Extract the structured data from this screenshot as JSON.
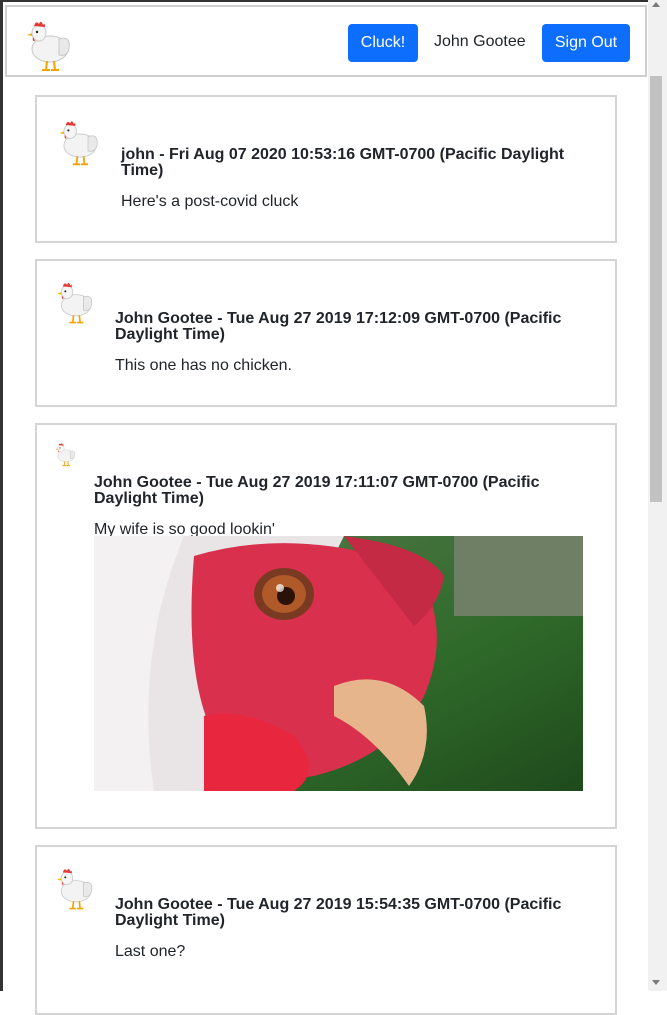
{
  "header": {
    "logo": "chicken-icon",
    "cluck_label": "Cluck!",
    "user_name": "John Gootee",
    "signout_label": "Sign Out"
  },
  "colors": {
    "primary": "#0d6efd",
    "border": "#d4d4d4"
  },
  "posts": [
    {
      "meta": "john - Fri Aug 07 2020 10:53:16 GMT-0700 (Pacific Daylight Time)",
      "text": "Here's a post-covid cluck"
    },
    {
      "meta": "John Gootee - Tue Aug 27 2019 17:12:09 GMT-0700 (Pacific Daylight Time)",
      "text": "This one has no chicken."
    },
    {
      "meta": "John Gootee - Tue Aug 27 2019 17:11:07 GMT-0700 (Pacific Daylight Time)",
      "text": "My wife is so good lookin'",
      "image": "rooster-closeup-photo"
    },
    {
      "meta": "John Gootee - Tue Aug 27 2019 15:54:35 GMT-0700 (Pacific Daylight Time)",
      "text": "Last one?"
    }
  ]
}
